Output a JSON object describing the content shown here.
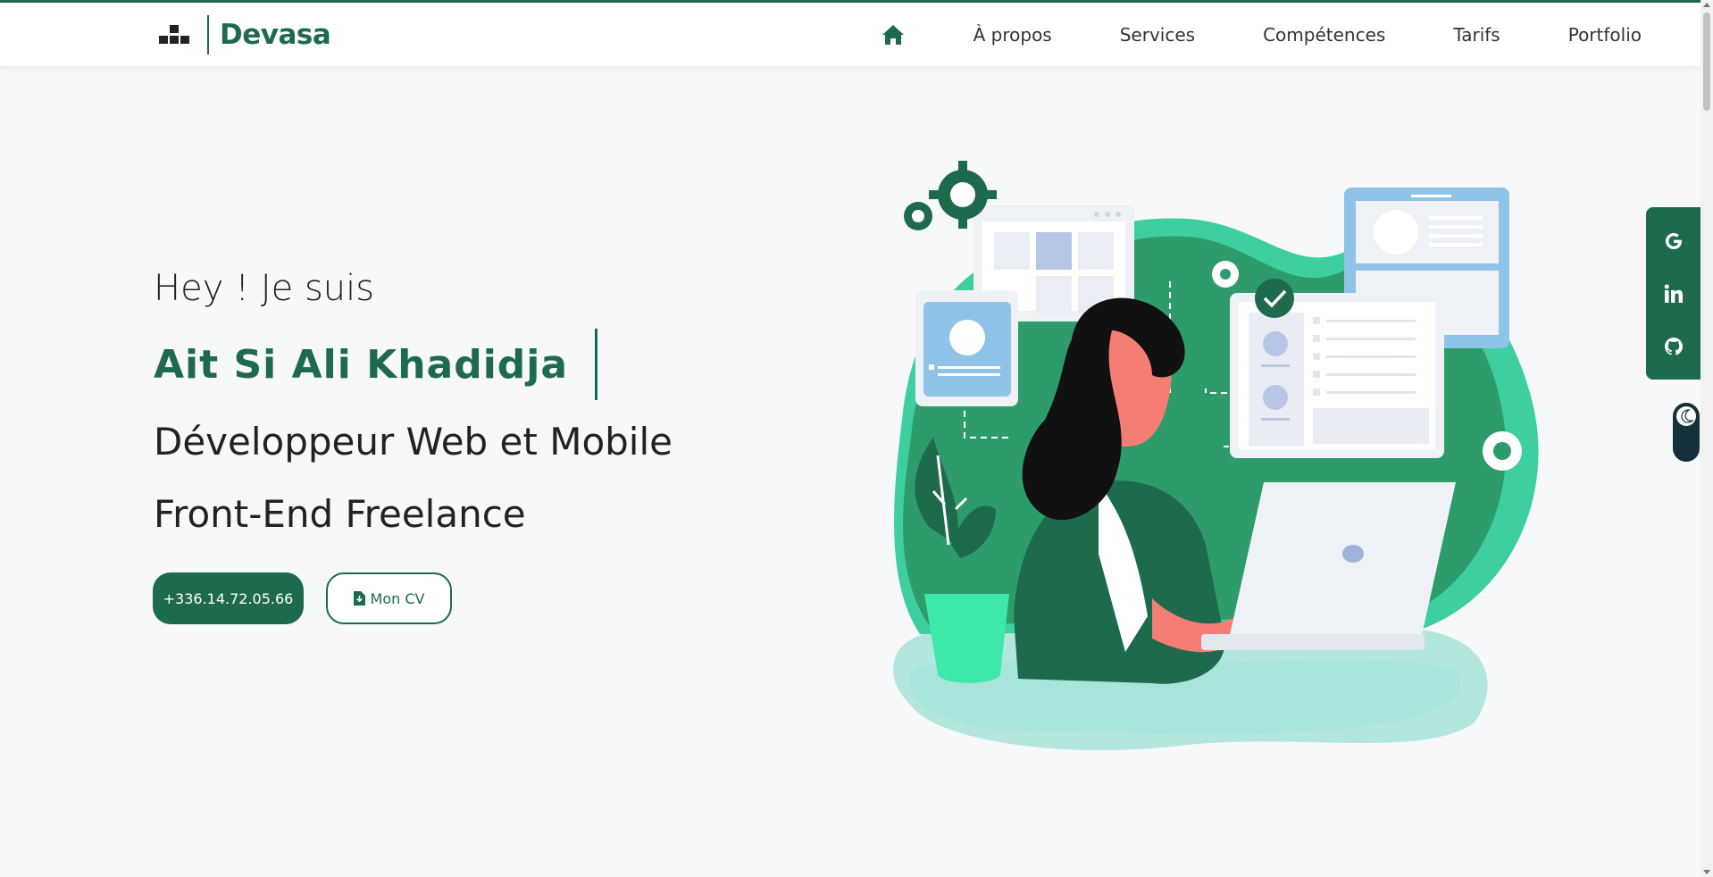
{
  "brand": {
    "name": "Devasa",
    "color": "#1e6a4c"
  },
  "nav": {
    "home_icon": "home-icon",
    "items": [
      {
        "label": "À propos"
      },
      {
        "label": "Services"
      },
      {
        "label": "Compétences"
      },
      {
        "label": "Tarifs"
      },
      {
        "label": "Portfolio"
      }
    ]
  },
  "hero": {
    "greeting": "Hey ! Je suis",
    "name": "Ait Si Ali Khadidja",
    "role_line1": "Développeur Web et Mobile",
    "role_line2": "Front-End Freelance",
    "phone_button": "+336.14.72.05.66",
    "cv_button": "Mon CV",
    "cv_icon": "file-download-icon"
  },
  "social": {
    "icons": [
      "google-icon",
      "linkedin-icon",
      "github-icon"
    ]
  },
  "theme_toggle": {
    "icon": "moon-icon"
  },
  "colors": {
    "accent": "#1e6a4c",
    "background": "#f7f8f9",
    "illustration_green": "#2e9c6a",
    "illustration_light": "#3ecfa0"
  }
}
